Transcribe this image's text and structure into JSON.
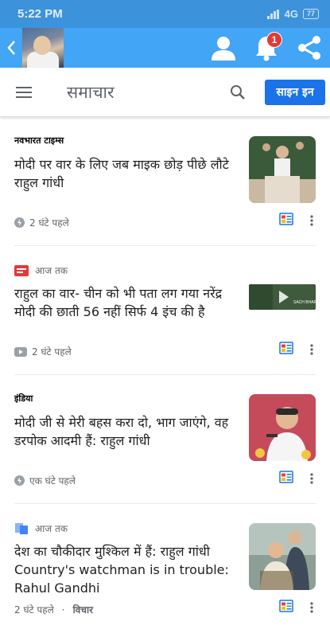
{
  "status_bar": {
    "time": "5:22 PM",
    "network": "4G",
    "battery": "77"
  },
  "header": {
    "title": "समाचार",
    "signin_label": "साइन इन",
    "notification_count": "1"
  },
  "articles": [
    {
      "source": "नवभारत टाइम्स",
      "headline": "मोदी पर वार के लिए जब माइक छोड़ पीछे लौटे राहुल गांधी",
      "time": "2 घंटे पहले",
      "meta_icon": "amp-lightning-icon",
      "extra": ""
    },
    {
      "source": "आज तक",
      "headline": "राहुल का वार- चीन को भी पता लग गया नरेंद्र मोदी की छाती 56 नहीं सिर्फ 4 इंच की है",
      "time": "2 घंटे पहले",
      "meta_icon": "video-play-icon",
      "extra": "",
      "thumb_caption": "SACH BHARAT"
    },
    {
      "source": "इंडिया",
      "headline": "मोदी जी से मेरी बहस करा दो, भाग जाएंगे, वह डरपोक आदमी हैं: राहुल गांधी",
      "time": "एक घंटे पहले",
      "meta_icon": "amp-lightning-icon",
      "extra": ""
    },
    {
      "source": "आज तक",
      "headline": "देश का चौकीदार मुश्किल में हैं: राहुल गांधी Country's watchman is in trouble: Rahul Gandhi",
      "time": "2 घंटे पहले",
      "meta_icon": "",
      "extra": "विचार"
    }
  ]
}
